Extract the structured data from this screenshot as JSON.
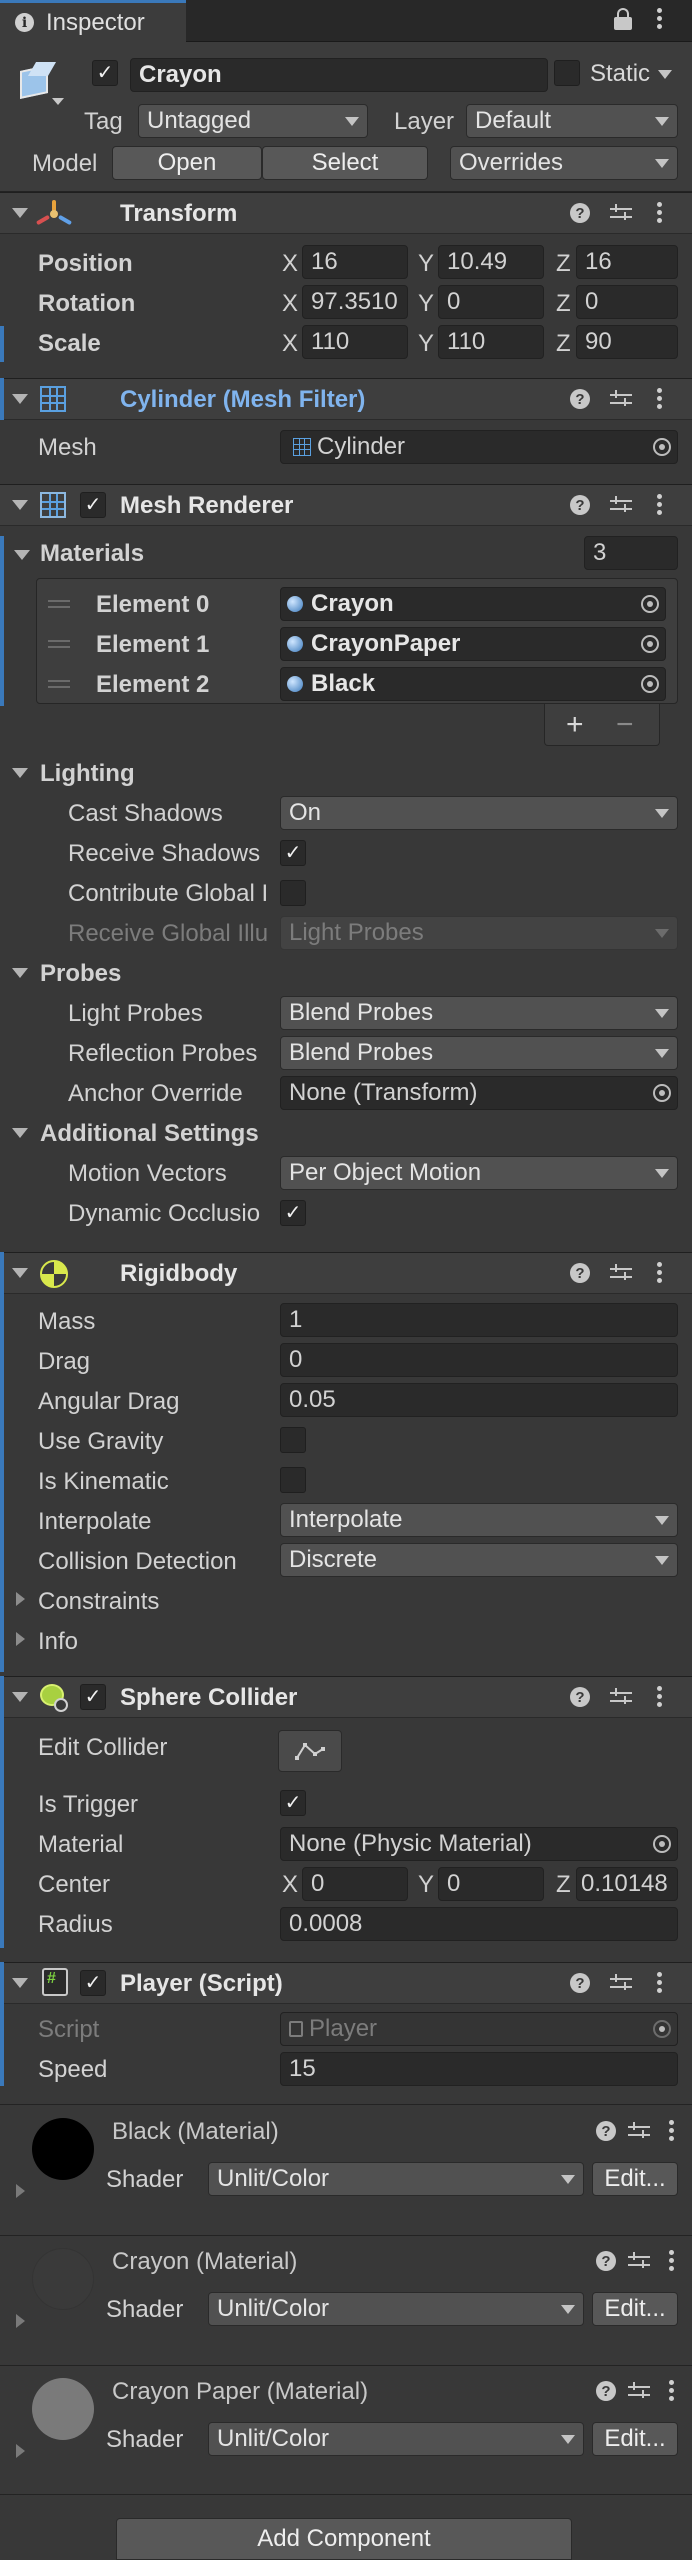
{
  "tab": {
    "title": "Inspector"
  },
  "object": {
    "name": "Crayon",
    "static_label": "Static",
    "tag_label": "Tag",
    "tag_value": "Untagged",
    "layer_label": "Layer",
    "layer_value": "Default",
    "model_label": "Model",
    "open_label": "Open",
    "select_label": "Select",
    "overrides_label": "Overrides"
  },
  "transform": {
    "title": "Transform",
    "rows": [
      {
        "label": "Position",
        "x": "16",
        "y": "10.49",
        "z": "16"
      },
      {
        "label": "Rotation",
        "x": "97.3510",
        "y": "0",
        "z": "0"
      },
      {
        "label": "Scale",
        "x": "110",
        "y": "110",
        "z": "90"
      }
    ],
    "axes": [
      "X",
      "Y",
      "Z"
    ]
  },
  "mesh_filter": {
    "title": "Cylinder (Mesh Filter)",
    "mesh_label": "Mesh",
    "mesh_value": "Cylinder"
  },
  "mesh_renderer": {
    "title": "Mesh Renderer",
    "materials_label": "Materials",
    "materials_count": "3",
    "elements": [
      {
        "label": "Element 0",
        "value": "Crayon"
      },
      {
        "label": "Element 1",
        "value": "CrayonPaper"
      },
      {
        "label": "Element 2",
        "value": "Black"
      }
    ],
    "plus": "+",
    "minus": "−",
    "lighting_label": "Lighting",
    "cast_shadows_label": "Cast Shadows",
    "cast_shadows_value": "On",
    "receive_shadows_label": "Receive Shadows",
    "contribute_gi_label": "Contribute Global I",
    "receive_gi_label": "Receive Global Illu",
    "receive_gi_value": "Light Probes",
    "probes_label": "Probes",
    "light_probes_label": "Light Probes",
    "light_probes_value": "Blend Probes",
    "reflection_probes_label": "Reflection Probes",
    "reflection_probes_value": "Blend Probes",
    "anchor_override_label": "Anchor Override",
    "anchor_override_value": "None (Transform)",
    "additional_label": "Additional Settings",
    "motion_vectors_label": "Motion Vectors",
    "motion_vectors_value": "Per Object Motion",
    "dynamic_occlusion_label": "Dynamic Occlusio"
  },
  "rigidbody": {
    "title": "Rigidbody",
    "mass_label": "Mass",
    "mass_value": "1",
    "drag_label": "Drag",
    "drag_value": "0",
    "angular_drag_label": "Angular Drag",
    "angular_drag_value": "0.05",
    "use_gravity_label": "Use Gravity",
    "is_kinematic_label": "Is Kinematic",
    "interpolate_label": "Interpolate",
    "interpolate_value": "Interpolate",
    "collision_label": "Collision Detection",
    "collision_value": "Discrete",
    "constraints_label": "Constraints",
    "info_label": "Info"
  },
  "sphere_collider": {
    "title": "Sphere Collider",
    "edit_collider_label": "Edit Collider",
    "is_trigger_label": "Is Trigger",
    "material_label": "Material",
    "material_value": "None (Physic Material)",
    "center_label": "Center",
    "center_x": "0",
    "center_y": "0",
    "center_z": "0.10148",
    "radius_label": "Radius",
    "radius_value": "0.0008"
  },
  "player_script": {
    "title": "Player (Script)",
    "script_label": "Script",
    "script_value": "Player",
    "speed_label": "Speed",
    "speed_value": "15"
  },
  "materials": [
    {
      "title": "Black (Material)",
      "shader_label": "Shader",
      "shader_value": "Unlit/Color",
      "edit_label": "Edit...",
      "color": "#000000"
    },
    {
      "title": "Crayon (Material)",
      "shader_label": "Shader",
      "shader_value": "Unlit/Color",
      "edit_label": "Edit...",
      "color": "#3a3a3a"
    },
    {
      "title": "Crayon Paper (Material)",
      "shader_label": "Shader",
      "shader_value": "Unlit/Color",
      "edit_label": "Edit...",
      "color": "#7a7a7a"
    }
  ],
  "add_component_label": "Add Component",
  "colors": {
    "accent": "#3a79bb",
    "link_title": "#80b4ee",
    "background": "#383838",
    "field": "#2a2a2a"
  }
}
